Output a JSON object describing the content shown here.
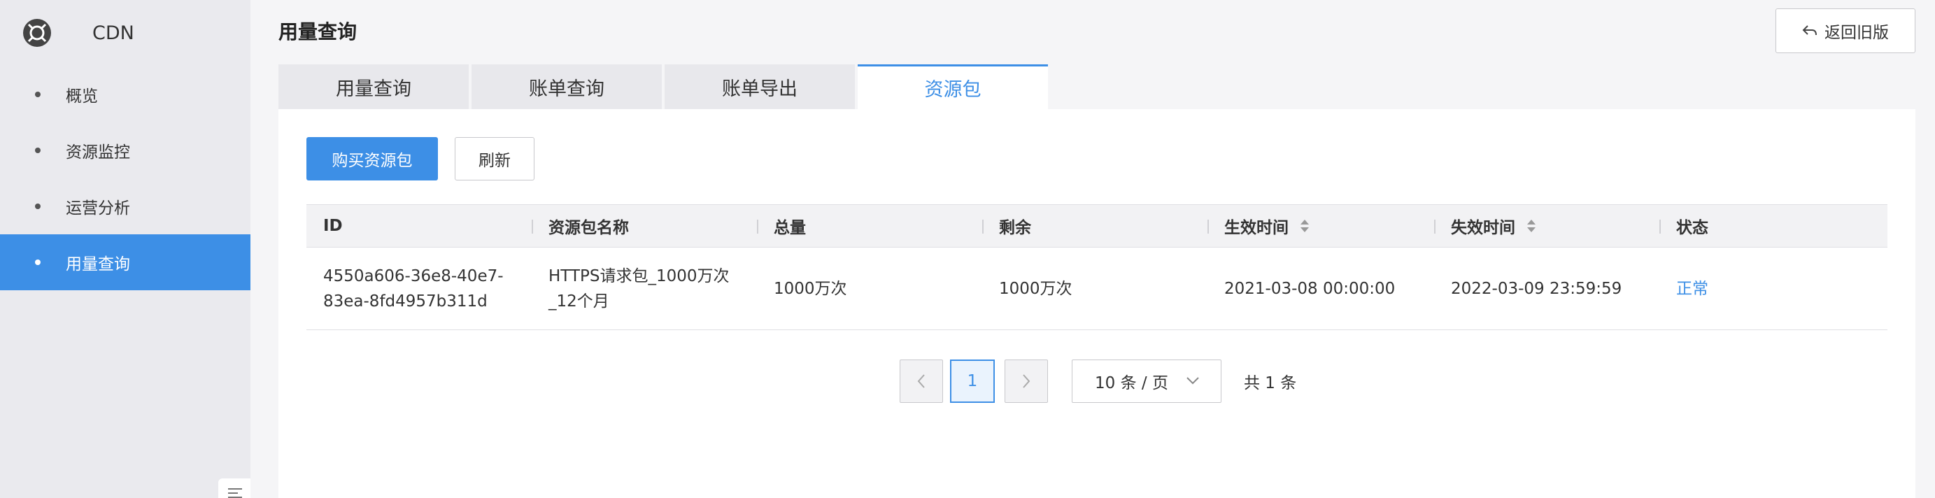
{
  "sidebar": {
    "brand": "CDN",
    "items": [
      {
        "label": "概览"
      },
      {
        "label": "资源监控"
      },
      {
        "label": "运营分析"
      },
      {
        "label": "用量查询"
      }
    ]
  },
  "header": {
    "title": "用量查询",
    "back_label": "返回旧版"
  },
  "tabs": [
    {
      "label": "用量查询"
    },
    {
      "label": "账单查询"
    },
    {
      "label": "账单导出"
    },
    {
      "label": "资源包"
    }
  ],
  "toolbar": {
    "buy_label": "购买资源包",
    "refresh_label": "刷新"
  },
  "table": {
    "columns": [
      "ID",
      "资源包名称",
      "总量",
      "剩余",
      "生效时间",
      "失效时间",
      "状态"
    ],
    "rows": [
      {
        "id_line1": "4550a606-36e8-40e7-",
        "id_line2": "83ea-8fd4957b311d",
        "name_line1": "HTTPS请求包_1000万次",
        "name_line2": "_12个月",
        "total": "1000万次",
        "remaining": "1000万次",
        "start": "2021-03-08 00:00:00",
        "end": "2022-03-09 23:59:59",
        "status": "正常"
      }
    ]
  },
  "pagination": {
    "current_page": "1",
    "page_size": "10 条 / 页",
    "total": "共 1 条"
  },
  "colors": {
    "accent": "#3d8fe6",
    "sidebar_bg": "#eaeaee"
  }
}
